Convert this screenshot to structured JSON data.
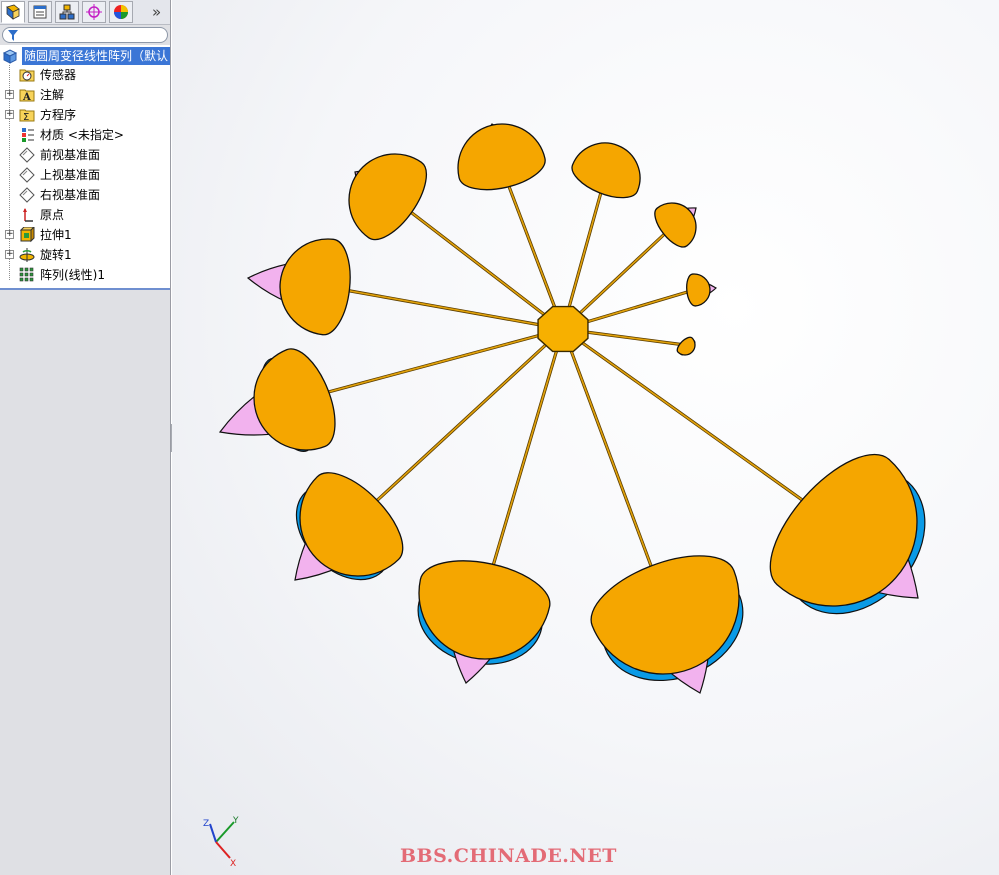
{
  "panel": {
    "tabs": [
      {
        "name": "featuremanager-tab",
        "icon": "feature-tree-icon",
        "active": true
      },
      {
        "name": "propertymanager-tab",
        "icon": "property-manager-icon",
        "active": false
      },
      {
        "name": "configurationmanager-tab",
        "icon": "configuration-icon",
        "active": false
      },
      {
        "name": "dimxpert-tab",
        "icon": "dimxpert-icon",
        "active": false
      },
      {
        "name": "appearance-tab",
        "icon": "appearance-icon",
        "active": false
      }
    ],
    "more": "»",
    "filter_icon": "filter-icon"
  },
  "tree": {
    "root": "随圆周变径线性阵列（默认",
    "items": [
      {
        "label": "传感器",
        "icon": "sensor-icon",
        "expand": false
      },
      {
        "label": "注解",
        "icon": "annotation-icon",
        "expand": true
      },
      {
        "label": "方程序",
        "icon": "equation-icon",
        "expand": true
      },
      {
        "label": "材质 <未指定>",
        "icon": "material-icon",
        "expand": false
      },
      {
        "label": "前视基准面",
        "icon": "plane-icon",
        "expand": false
      },
      {
        "label": "上视基准面",
        "icon": "plane-icon",
        "expand": false
      },
      {
        "label": "右视基准面",
        "icon": "plane-icon",
        "expand": false
      },
      {
        "label": "原点",
        "icon": "origin-icon",
        "expand": false
      },
      {
        "label": "拉伸1",
        "icon": "extrude-icon",
        "expand": true
      },
      {
        "label": "旋转1",
        "icon": "revolve-icon",
        "expand": true
      },
      {
        "label": "阵列(线性)1",
        "icon": "linear-pattern-icon",
        "expand": false
      }
    ]
  },
  "viewport": {
    "watermark": "BBS.CHINADE.NET",
    "triad": {
      "x": "X",
      "y": "Y",
      "z": "Z"
    },
    "colors": {
      "orange": "#f5a600",
      "blue": "#0a9ae6",
      "pink": "#f2b2ee",
      "hub": "#f7b000"
    }
  }
}
